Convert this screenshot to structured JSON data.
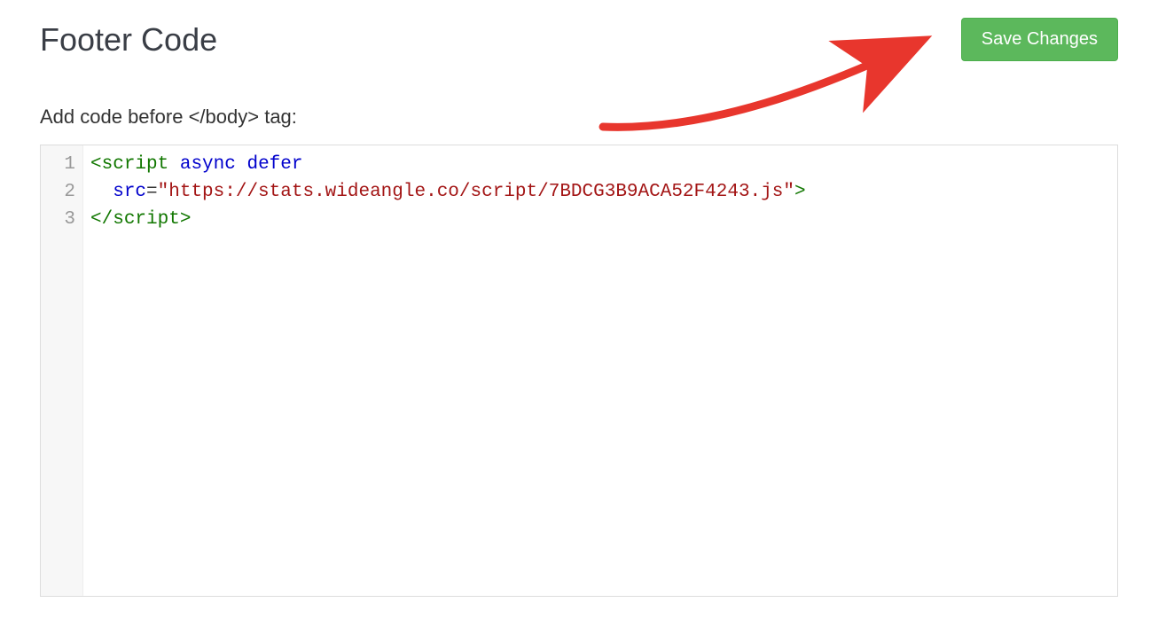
{
  "header": {
    "title": "Footer Code",
    "save_label": "Save Changes"
  },
  "field": {
    "label_prefix": "Add code before ",
    "label_tag": "</body>",
    "label_suffix": " tag:"
  },
  "editor": {
    "line_numbers": [
      "1",
      "2",
      "3"
    ],
    "lines": [
      {
        "tokens": [
          {
            "cls": "tag-bracket",
            "t": "<"
          },
          {
            "cls": "tag-name",
            "t": "script"
          },
          {
            "cls": "",
            "t": " "
          },
          {
            "cls": "attr-name",
            "t": "async"
          },
          {
            "cls": "",
            "t": " "
          },
          {
            "cls": "attr-name",
            "t": "defer"
          }
        ]
      },
      {
        "tokens": [
          {
            "cls": "",
            "t": "  "
          },
          {
            "cls": "attr-name",
            "t": "src"
          },
          {
            "cls": "eq",
            "t": "="
          },
          {
            "cls": "attr-value",
            "t": "\"https://stats.wideangle.co/script/7BDCG3B9ACA52F4243.js\""
          },
          {
            "cls": "tag-bracket",
            "t": ">"
          }
        ]
      },
      {
        "tokens": [
          {
            "cls": "tag-bracket",
            "t": "</"
          },
          {
            "cls": "tag-name",
            "t": "script"
          },
          {
            "cls": "tag-bracket",
            "t": ">"
          }
        ]
      }
    ]
  }
}
